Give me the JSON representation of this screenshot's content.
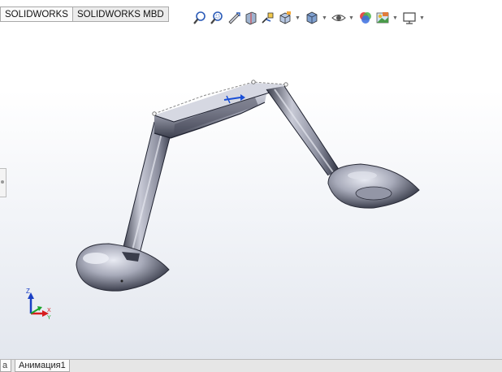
{
  "tabs": {
    "solidworks": "SOLIDWORKS",
    "mbd": "SOLIDWORKS MBD"
  },
  "toolbar": {
    "items": [
      {
        "icon": "zoom-to-fit-icon"
      },
      {
        "icon": "zoom-to-area-icon"
      },
      {
        "icon": "previous-view-icon"
      },
      {
        "icon": "section-view-icon"
      },
      {
        "icon": "dynamic-annotation-views-icon"
      },
      {
        "icon": "view-orientation-icon",
        "dropdown": true
      },
      {
        "icon": "display-style-icon",
        "dropdown": true
      },
      {
        "icon": "hide-show-items-icon",
        "dropdown": true
      },
      {
        "icon": "edit-appearance-icon"
      },
      {
        "icon": "apply-scene-icon",
        "dropdown": true
      },
      {
        "icon": "view-settings-icon",
        "dropdown": true
      }
    ]
  },
  "triad": {
    "z": "Z",
    "y": "Y",
    "x": "X"
  },
  "bottom": {
    "first_tab": "a",
    "animation_tab": "Анимация1"
  },
  "colors": {
    "model_body": "#b9bcc8",
    "model_dark": "#2e3140",
    "accent_blue": "#1a4fd6",
    "axis_red": "#d61e1e",
    "axis_green": "#19a52a"
  }
}
